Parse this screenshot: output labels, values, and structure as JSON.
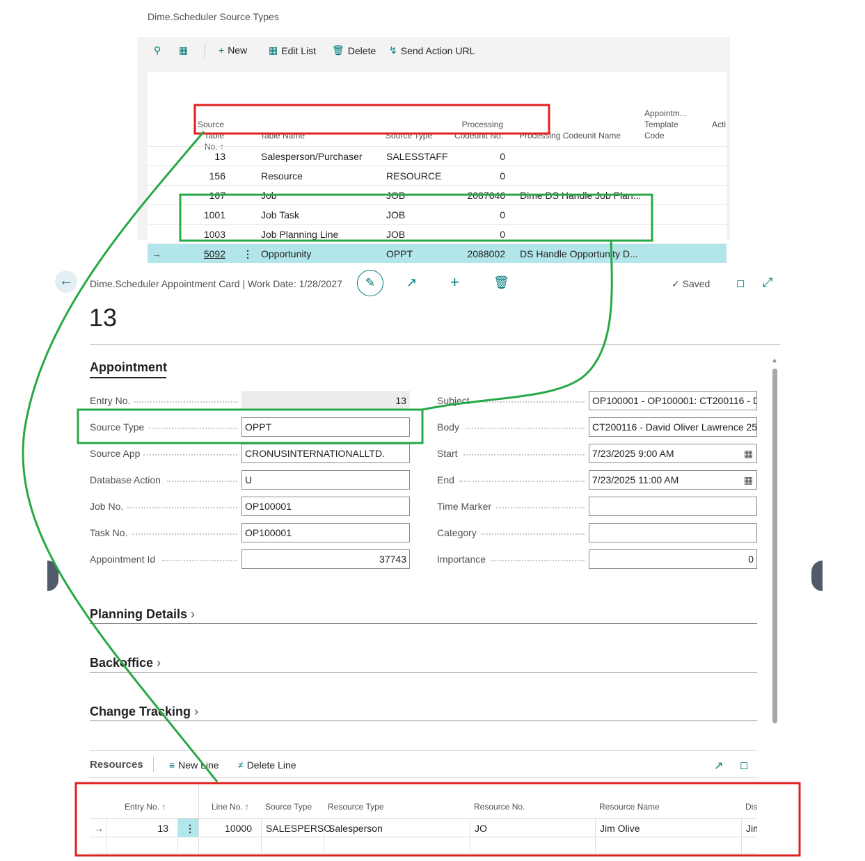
{
  "list": {
    "title": "Dime.Scheduler Source Types",
    "toolbar": {
      "new": "New",
      "edit_list": "Edit List",
      "delete": "Delete",
      "send_action_url": "Send Action URL"
    },
    "columns": {
      "source_table_no_1": "Source Table",
      "source_table_no_2": "No. ↑",
      "table_name": "Table Name",
      "source_type": "Source Type",
      "proc_codeunit_no_1": "Processing",
      "proc_codeunit_no_2": "Codeunit No.",
      "proc_codeunit_name": "Processing Codeunit Name",
      "appt_template_1": "Appointm...",
      "appt_template_2": "Template",
      "appt_template_3": "Code",
      "action": "Acti"
    },
    "rows": [
      {
        "no": "13",
        "table_name": "Salesperson/Purchaser",
        "source_type": "SALESSTAFF",
        "codeunit_no": "0",
        "codeunit_name": ""
      },
      {
        "no": "156",
        "table_name": "Resource",
        "source_type": "RESOURCE",
        "codeunit_no": "0",
        "codeunit_name": ""
      },
      {
        "no": "167",
        "table_name": "Job",
        "source_type": "JOB",
        "codeunit_no": "2087646",
        "codeunit_name": "Dime DS Handle Job Plan..."
      },
      {
        "no": "1001",
        "table_name": "Job Task",
        "source_type": "JOB",
        "codeunit_no": "0",
        "codeunit_name": ""
      },
      {
        "no": "1003",
        "table_name": "Job Planning Line",
        "source_type": "JOB",
        "codeunit_no": "0",
        "codeunit_name": ""
      },
      {
        "no": "5092",
        "table_name": "Opportunity",
        "source_type": "OPPT",
        "codeunit_no": "2088002",
        "codeunit_name": "DS Handle Opportunity D..."
      }
    ]
  },
  "card": {
    "caption": "Dime.Scheduler Appointment Card | Work Date: 1/28/2027",
    "saved": "Saved",
    "record_no": "13",
    "section": "Appointment",
    "left_fields": [
      {
        "label": "Entry No.",
        "value": "13"
      },
      {
        "label": "Source Type",
        "value": "OPPT"
      },
      {
        "label": "Source App",
        "value": "CRONUSINTERNATIONALLTD."
      },
      {
        "label": "Database Action",
        "value": "U"
      },
      {
        "label": "Job No.",
        "value": "OP100001"
      },
      {
        "label": "Task No.",
        "value": "OP100001"
      },
      {
        "label": "Appointment Id",
        "value": "37743"
      }
    ],
    "right_fields": [
      {
        "label": "Subject",
        "value": "OP100001 - OP100001: CT200116 - D"
      },
      {
        "label": "Body",
        "value": "CT200116 - David Oliver Lawrence 25"
      },
      {
        "label": "Start",
        "value": "7/23/2025 9:00 AM"
      },
      {
        "label": "End",
        "value": "7/23/2025 11:00 AM"
      },
      {
        "label": "Time Marker",
        "value": ""
      },
      {
        "label": "Category",
        "value": ""
      },
      {
        "label": "Importance",
        "value": "0"
      }
    ],
    "fasttabs": [
      "Planning Details",
      "Backoffice",
      "Change Tracking"
    ]
  },
  "resources": {
    "title": "Resources",
    "new_line": "New Line",
    "delete_line": "Delete Line",
    "columns": {
      "entry_no": "Entry No. ↑",
      "line_no": "Line No. ↑",
      "source_type": "Source Type",
      "resource_type": "Resource Type",
      "resource_no": "Resource No.",
      "resource_name": "Resource Name",
      "dis": "Dis"
    },
    "row": {
      "entry_no": "13",
      "line_no": "10000",
      "source_type": "SALESPERSO",
      "resource_type": "Salesperson",
      "resource_no": "JO",
      "resource_name": "Jim Olive",
      "dis": "Jim"
    }
  },
  "colors": {
    "accent": "#00787a",
    "selected_row": "#b2e6ea",
    "highlight_red": "#e0201e",
    "highlight_green": "#27a846"
  }
}
